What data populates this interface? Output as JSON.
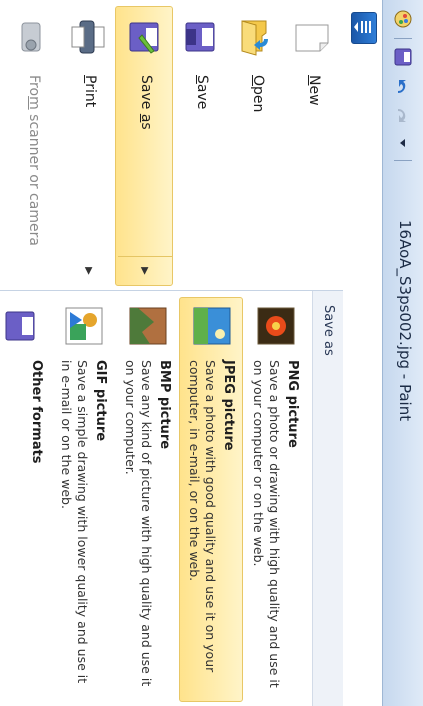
{
  "window": {
    "title": "16AoA_S3ps002.jpg - Paint"
  },
  "quick_access": {
    "icons": [
      "paint-app-icon",
      "save-icon",
      "undo-icon",
      "redo-icon",
      "customize-quick-access-icon"
    ]
  },
  "left_menu": {
    "items": [
      {
        "label": "New",
        "u": "N",
        "rest": "ew",
        "icon": "new-icon"
      },
      {
        "label": "Open",
        "u": "O",
        "rest": "pen",
        "icon": "open-icon"
      },
      {
        "label": "Save",
        "u": "S",
        "rest": "ave",
        "icon": "save-icon"
      },
      {
        "label": "Save as",
        "pre": "Save ",
        "u": "a",
        "rest": "s",
        "icon": "save-as-icon",
        "selected": true
      },
      {
        "label": "Print",
        "u": "P",
        "rest": "rint",
        "icon": "print-icon"
      },
      {
        "label": "From scanner or camera",
        "pre": "Fro",
        "u": "m",
        "rest": " scanner or camera",
        "icon": "scanner-icon",
        "disabled": true
      }
    ]
  },
  "submenu": {
    "heading": "Save as",
    "items": [
      {
        "title": "PNG picture",
        "desc": "Save a photo or drawing with high quality and use it on your computer or on the web.",
        "icon": "png-picture-icon"
      },
      {
        "title": "JPEG picture",
        "desc": "Save a photo with good quality and use it on your computer, in e-mail, or on the web.",
        "icon": "jpeg-picture-icon",
        "selected": true
      },
      {
        "title": "BMP picture",
        "desc": "Save any kind of picture with high quality and use it on your computer.",
        "icon": "bmp-picture-icon"
      },
      {
        "title": "GIF picture",
        "desc": "Save a simple drawing with lower quality and use it in e-mail or on the web.",
        "icon": "gif-picture-icon"
      },
      {
        "title": "Other formats",
        "desc": "",
        "icon": "other-formats-icon"
      }
    ]
  }
}
